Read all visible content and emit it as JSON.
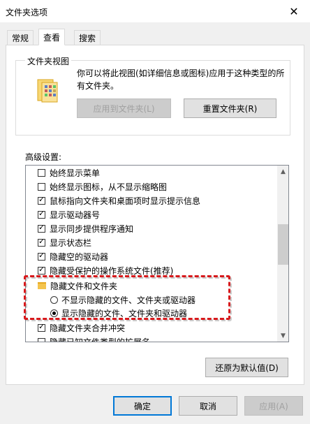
{
  "window": {
    "title": "文件夹选项",
    "close_glyph": "✕"
  },
  "tabs": [
    {
      "label": "常规",
      "active": false
    },
    {
      "label": "查看",
      "active": true
    },
    {
      "label": "搜索",
      "active": false
    }
  ],
  "folder_views": {
    "legend": "文件夹视图",
    "description": "你可以将此视图(如详细信息或图标)应用于这种类型的所有文件夹。",
    "apply_button": "应用到文件夹(L)",
    "reset_button": "重置文件夹(R)"
  },
  "advanced": {
    "label": "高级设置:",
    "items": [
      {
        "type": "checkbox",
        "checked": false,
        "label": "始终显示菜单"
      },
      {
        "type": "checkbox",
        "checked": false,
        "label": "始终显示图标，从不显示缩略图"
      },
      {
        "type": "checkbox",
        "checked": true,
        "label": "鼠标指向文件夹和桌面项时显示提示信息"
      },
      {
        "type": "checkbox",
        "checked": true,
        "label": "显示驱动器号"
      },
      {
        "type": "checkbox",
        "checked": true,
        "label": "显示同步提供程序通知"
      },
      {
        "type": "checkbox",
        "checked": true,
        "label": "显示状态栏"
      },
      {
        "type": "checkbox",
        "checked": true,
        "label": "隐藏空的驱动器"
      },
      {
        "type": "checkbox",
        "checked": true,
        "label": "隐藏受保护的操作系统文件(推荐)"
      },
      {
        "type": "folder",
        "label": "隐藏文件和文件夹"
      },
      {
        "type": "radio",
        "checked": false,
        "label": "不显示隐藏的文件、文件夹或驱动器"
      },
      {
        "type": "radio",
        "checked": true,
        "label": "显示隐藏的文件、文件夹和驱动器"
      },
      {
        "type": "checkbox",
        "checked": true,
        "label": "隐藏文件夹合并冲突"
      },
      {
        "type": "checkbox",
        "checked": false,
        "label": "隐藏已知文件类型的扩展名"
      }
    ],
    "restore_button": "还原为默认值(D)"
  },
  "footer": {
    "ok_button": "确定",
    "cancel_button": "取消",
    "apply_button": "应用(A)"
  },
  "colors": {
    "highlight_border": "#d7191c",
    "folder_yellow": "#f4c44d"
  }
}
